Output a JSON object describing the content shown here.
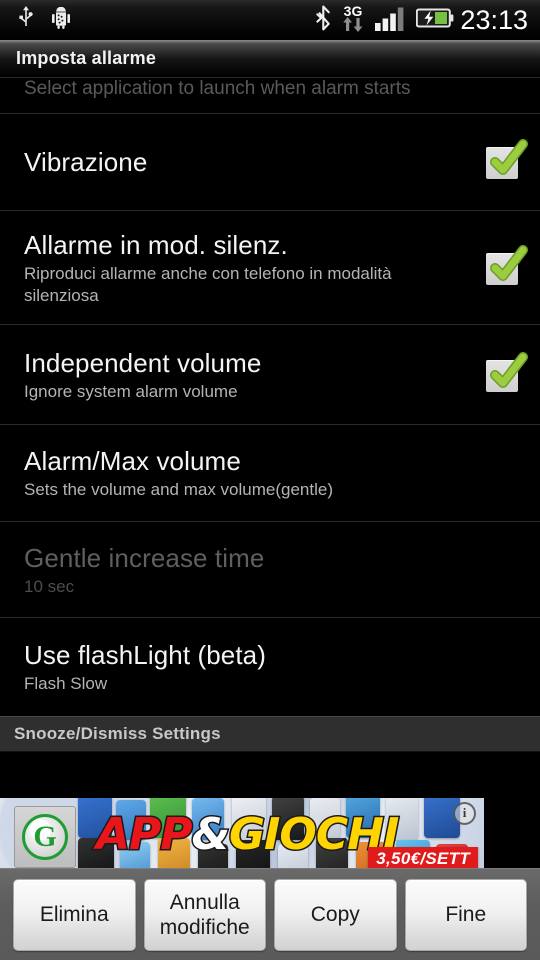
{
  "status_bar": {
    "icons_left": [
      "usb-icon",
      "android-debug-icon"
    ],
    "icons_right": [
      "bluetooth-icon",
      "3g-data-icon",
      "signal-bars-icon",
      "battery-charging-icon"
    ],
    "data_label": "3G",
    "clock": "23:13"
  },
  "title_bar": {
    "title": "Imposta allarme"
  },
  "list": {
    "partial_row": {
      "summary": "Select application to launch when alarm starts"
    },
    "items": [
      {
        "title": "Vibrazione",
        "summary": "",
        "checkbox": true,
        "checked": true,
        "disabled": false,
        "name": "vibrazione"
      },
      {
        "title": "Allarme in mod. silenz.",
        "summary": "Riproduci allarme anche con telefono in modalità silenziosa",
        "checkbox": true,
        "checked": true,
        "disabled": false,
        "name": "allarme-in-mod-silenz"
      },
      {
        "title": "Independent volume",
        "summary": "Ignore system alarm volume",
        "checkbox": true,
        "checked": true,
        "disabled": false,
        "name": "independent-volume"
      },
      {
        "title": "Alarm/Max volume",
        "summary": "Sets the volume and max volume(gentle)",
        "checkbox": false,
        "checked": false,
        "disabled": false,
        "name": "alarm-max-volume"
      },
      {
        "title": "Gentle increase time",
        "summary": "10 sec",
        "checkbox": false,
        "checked": false,
        "disabled": true,
        "name": "gentle-increase-time"
      },
      {
        "title": "Use flashLight (beta)",
        "summary": "Flash Slow",
        "checkbox": false,
        "checked": false,
        "disabled": false,
        "name": "use-flashlight-beta"
      }
    ],
    "section_header": "Snooze/Dismiss Settings"
  },
  "ad": {
    "logo_letter": "G",
    "headline_part1": "APP",
    "headline_part2": "&",
    "headline_part3": "GIOCHI",
    "price": "3,50€/SETT",
    "info_label": "i"
  },
  "buttons": [
    {
      "label": "Elimina",
      "name": "elimina-button",
      "lines": [
        "Elimina"
      ]
    },
    {
      "label": "Annulla modifiche",
      "name": "annulla-modifiche-button",
      "lines": [
        "Annulla",
        "modifiche"
      ]
    },
    {
      "label": "Copy",
      "name": "copy-button",
      "lines": [
        "Copy"
      ]
    },
    {
      "label": "Fine",
      "name": "fine-button",
      "lines": [
        "Fine"
      ]
    }
  ],
  "colors": {
    "accent_check": "#8ec441",
    "section_header_bg": "#2f2f2f",
    "button_bar_bg": "#5a5a5a",
    "ad_red": "#e8161b",
    "ad_yellow": "#ffd400"
  }
}
